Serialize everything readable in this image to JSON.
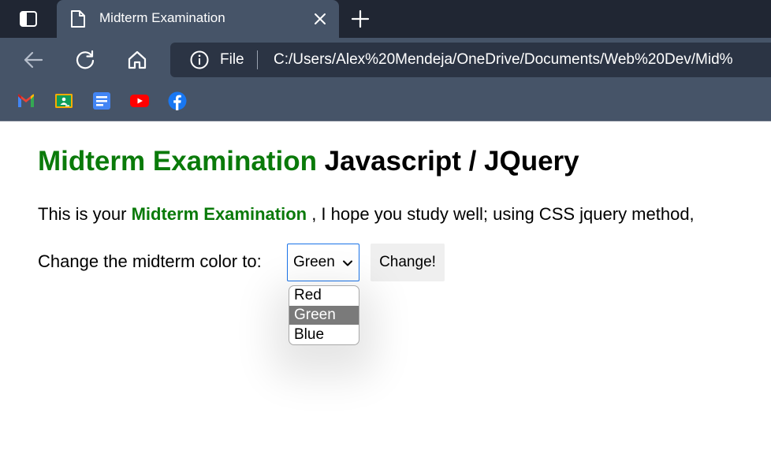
{
  "browser": {
    "tab_title": "Midterm Examination",
    "address_scheme": "File",
    "address_url": "C:/Users/Alex%20Mendeja/OneDrive/Documents/Web%20Dev/Mid%",
    "icons": {
      "tab_actions": "tab-actions-icon",
      "tab_favicon": "document-icon",
      "tab_close": "close-icon",
      "new_tab": "plus-icon",
      "back": "back-arrow-icon",
      "refresh": "refresh-icon",
      "home": "home-icon",
      "site_info": "info-icon"
    },
    "bookmarks": [
      {
        "name": "gmail",
        "icon": "gmail-icon"
      },
      {
        "name": "google-classroom",
        "icon": "classroom-icon"
      },
      {
        "name": "google-docs",
        "icon": "docs-icon"
      },
      {
        "name": "youtube",
        "icon": "youtube-icon"
      },
      {
        "name": "facebook",
        "icon": "facebook-icon"
      }
    ],
    "colors": {
      "tabbar": "#202633",
      "toolbar": "#465468",
      "addressbar": "#2b3444"
    }
  },
  "page": {
    "heading_accent": "Midterm Examination",
    "heading_rest": " Javascript / JQuery",
    "para_start": "This is your ",
    "para_accent": "Midterm Examination",
    "para_end": " , I hope you study well; using CSS jquery method,",
    "form_label": "Change the midterm color to:",
    "select_value": "Green",
    "select_options": [
      "Red",
      "Green",
      "Blue"
    ],
    "highlighted_option": "Green",
    "button_label": "Change!",
    "accent_color": "#0a7a0a",
    "focus_border_color": "#1a73e8"
  }
}
